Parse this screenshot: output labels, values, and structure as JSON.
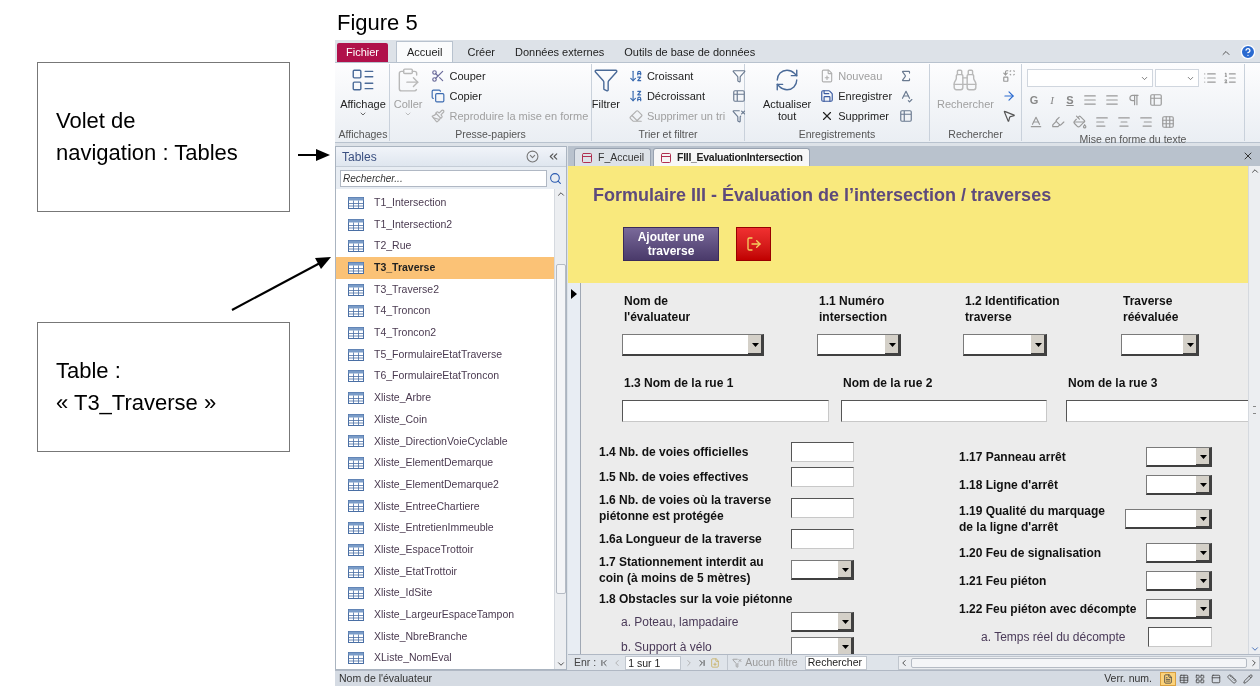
{
  "figure_caption": "Figure 5",
  "callouts": [
    {
      "text": "Volet de\nnavigation : Tables"
    },
    {
      "text": "Table :\n« T3_Traverse »"
    }
  ],
  "ribbon": {
    "tabs": [
      {
        "label": "Fichier",
        "kind": "file",
        "selected": false
      },
      {
        "label": "Accueil",
        "kind": "tab",
        "selected": true
      },
      {
        "label": "Créer",
        "kind": "tab",
        "selected": false
      },
      {
        "label": "Données externes",
        "kind": "tab",
        "selected": false
      },
      {
        "label": "Outils de base de données",
        "kind": "tab",
        "selected": false
      }
    ],
    "groups": [
      {
        "kind": "view",
        "label": "Affichages",
        "large": {
          "label": "Affichage",
          "disabled": false
        }
      },
      {
        "kind": "clipboard",
        "label": "Presse-papiers",
        "large": {
          "label": "Coller",
          "disabled": true
        },
        "small": [
          {
            "label": "Couper",
            "disabled": false
          },
          {
            "label": "Copier",
            "disabled": false
          },
          {
            "label": "Reproduire la mise en forme",
            "disabled": true
          }
        ]
      },
      {
        "kind": "sort",
        "label": "Trier et filtrer",
        "large": {
          "label": "Filtrer",
          "disabled": false
        },
        "small": [
          {
            "label": "Croissant",
            "disabled": false
          },
          {
            "label": "Décroissant",
            "disabled": false
          },
          {
            "label": "Supprimer un tri",
            "disabled": true
          }
        ]
      },
      {
        "kind": "records",
        "label": "Enregistrements",
        "large": {
          "label": "Actualiser\ntout",
          "disabled": false
        },
        "small": [
          {
            "label": "Nouveau",
            "disabled": true
          },
          {
            "label": "Enregistrer",
            "disabled": false
          },
          {
            "label": "Supprimer",
            "disabled": false
          }
        ]
      },
      {
        "kind": "find",
        "label": "Rechercher",
        "large": {
          "label": "Rechercher",
          "disabled": true
        }
      },
      {
        "kind": "font",
        "label": "Mise en forme du texte",
        "keys": [
          "G",
          "I",
          "S"
        ]
      }
    ]
  },
  "nav_pane": {
    "title": "Tables",
    "search_placeholder": "Rechercher...",
    "items": [
      {
        "label": "T1_Intersection",
        "selected": false
      },
      {
        "label": "T1_Intersection2",
        "selected": false
      },
      {
        "label": "T2_Rue",
        "selected": false
      },
      {
        "label": "T3_Traverse",
        "selected": true
      },
      {
        "label": "T3_Traverse2",
        "selected": false
      },
      {
        "label": "T4_Troncon",
        "selected": false
      },
      {
        "label": "T4_Troncon2",
        "selected": false
      },
      {
        "label": "T5_FormulaireEtatTraverse",
        "selected": false
      },
      {
        "label": "T6_FormulaireEtatTroncon",
        "selected": false
      },
      {
        "label": "Xliste_Arbre",
        "selected": false
      },
      {
        "label": "Xliste_Coin",
        "selected": false
      },
      {
        "label": "Xliste_DirectionVoieCyclable",
        "selected": false
      },
      {
        "label": "Xliste_ElementDemarque",
        "selected": false
      },
      {
        "label": "Xliste_ElementDemarque2",
        "selected": false
      },
      {
        "label": "Xliste_EntreeChartiere",
        "selected": false
      },
      {
        "label": "Xliste_EntretienImmeuble",
        "selected": false
      },
      {
        "label": "Xliste_EspaceTrottoir",
        "selected": false
      },
      {
        "label": "Xliste_EtatTrottoir",
        "selected": false
      },
      {
        "label": "Xliste_IdSite",
        "selected": false
      },
      {
        "label": "Xliste_LargeurEspaceTampon",
        "selected": false
      },
      {
        "label": "Xliste_NbreBranche",
        "selected": false
      },
      {
        "label": "XListe_NomEval",
        "selected": false
      }
    ]
  },
  "document_tabs": [
    {
      "label": "F_Accueil",
      "selected": false
    },
    {
      "label": "FIII_EvaluationIntersection",
      "selected": true
    }
  ],
  "form": {
    "title": "Formulaire III - Évaluation de l’intersection / traverses",
    "add_button": "Ajouter une\ntraverse",
    "top_fields": [
      {
        "label": "Nom de\nl'évaluateur"
      },
      {
        "label": "1.1 Numéro\nintersection"
      },
      {
        "label": "1.2 Identification\ntraverse"
      },
      {
        "label": "Traverse\nréévaluée"
      }
    ],
    "street_fields": [
      {
        "label": "1.3 Nom de la rue 1"
      },
      {
        "label": "Nom de la rue 2"
      },
      {
        "label": "Nom de la rue 3"
      }
    ],
    "left_fields": [
      {
        "kind": "text",
        "label": "1.4 Nb. de voies officielles"
      },
      {
        "kind": "text",
        "label": "1.5 Nb. de voies effectives"
      },
      {
        "kind": "text",
        "label": "1.6 Nb. de voies où la traverse\npiétonne est protégée"
      },
      {
        "kind": "text",
        "label": "1.6a Longueur de la traverse"
      },
      {
        "kind": "combo",
        "label": "1.7 Stationnement interdit au\ncoin (à moins de 5 mètres)"
      },
      {
        "kind": "heading",
        "label": "1.8 Obstacles sur la voie piétonne"
      },
      {
        "kind": "subcombo",
        "label": "a. Poteau, lampadaire"
      },
      {
        "kind": "subcombo",
        "label": "b. Support à vélo"
      }
    ],
    "right_fields": [
      {
        "kind": "combo",
        "label": "1.17 Panneau arrêt"
      },
      {
        "kind": "combo",
        "label": "1.18 Ligne d'arrêt"
      },
      {
        "kind": "combo",
        "label": "1.19 Qualité du marquage\nde la ligne d'arrêt"
      },
      {
        "kind": "combo",
        "label": "1.20 Feu de signalisation"
      },
      {
        "kind": "combo",
        "label": "1.21 Feu piéton"
      },
      {
        "kind": "combo",
        "label": "1.22 Feu piéton avec décompte"
      },
      {
        "kind": "subtext",
        "label": "a. Temps réel du décompte"
      }
    ]
  },
  "record_nav": {
    "label": "Enr :",
    "position": "1 sur 1",
    "filter": "Aucun filtre",
    "search_placeholder": "Rechercher"
  },
  "status_bar": {
    "text": "Nom de l'évaluateur",
    "indicator": "Verr. num.",
    "views": [
      {
        "selected": true
      },
      {
        "selected": false
      },
      {
        "selected": false
      },
      {
        "selected": false
      },
      {
        "selected": false
      },
      {
        "selected": false
      }
    ]
  }
}
